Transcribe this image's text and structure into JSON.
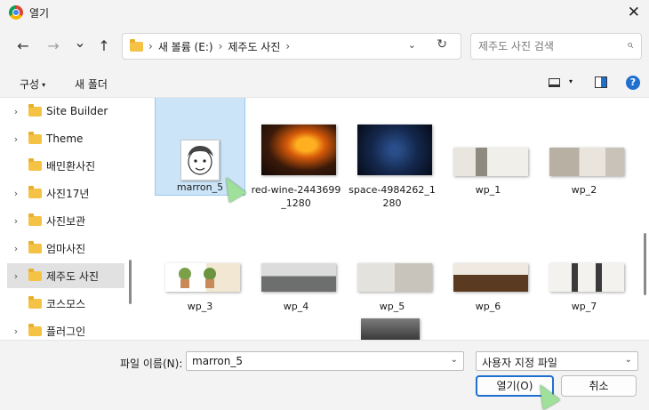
{
  "window": {
    "title": "열기",
    "close_glyph": "✕"
  },
  "nav": {
    "back_glyph": "←",
    "forward_glyph": "→",
    "recent_glyph": "⌄",
    "up_glyph": "↑",
    "breadcrumb": [
      "새 볼륨 (E:)",
      "제주도 사진"
    ],
    "separator": "›",
    "dropdown_glyph": "⌄",
    "refresh_glyph": "↻",
    "search_placeholder": "제주도 사진 검색",
    "search_glyph": "⌕"
  },
  "toolbar": {
    "organize_label": "구성",
    "organize_arrow": "▾",
    "new_folder_label": "새 폴더",
    "view_arrow": "▾",
    "help_glyph": "?"
  },
  "sidebar": {
    "items": [
      {
        "label": "Site Builder",
        "chevron": "›",
        "selected": false
      },
      {
        "label": "Theme",
        "chevron": "›",
        "selected": false
      },
      {
        "label": "배민환사진",
        "chevron": "",
        "selected": false
      },
      {
        "label": "사진17년",
        "chevron": "›",
        "selected": false
      },
      {
        "label": "사진보관",
        "chevron": "›",
        "selected": false
      },
      {
        "label": "엄마사진",
        "chevron": "›",
        "selected": false
      },
      {
        "label": "제주도 사진",
        "chevron": "›",
        "selected": true
      },
      {
        "label": "코스모스",
        "chevron": "",
        "selected": false
      },
      {
        "label": "플러그인",
        "chevron": "›",
        "selected": false
      }
    ]
  },
  "files": [
    {
      "name": "marron_5",
      "selected": true
    },
    {
      "name": "red-wine-2443699_1280",
      "selected": false
    },
    {
      "name": "space-4984262_1280",
      "selected": false
    },
    {
      "name": "wp_1",
      "selected": false
    },
    {
      "name": "wp_2",
      "selected": false
    },
    {
      "name": "wp_3",
      "selected": false
    },
    {
      "name": "wp_4",
      "selected": false
    },
    {
      "name": "wp_5",
      "selected": false
    },
    {
      "name": "wp_6",
      "selected": false
    },
    {
      "name": "wp_7",
      "selected": false
    }
  ],
  "footer": {
    "filename_label": "파일 이름(N):",
    "filename_value": "marron_5",
    "filename_dropdown_glyph": "⌄",
    "filetype_value": "사용자 지정 파일",
    "filetype_dropdown_glyph": "⌄",
    "open_label": "열기(O)",
    "cancel_label": "취소"
  },
  "colors": {
    "accent": "#1f6fd1",
    "selection_bg": "#cce4f7",
    "sidebar_selected_bg": "#e1e1e1",
    "chrome_bg": "#f3f3f3",
    "folder": "#f4c244"
  }
}
